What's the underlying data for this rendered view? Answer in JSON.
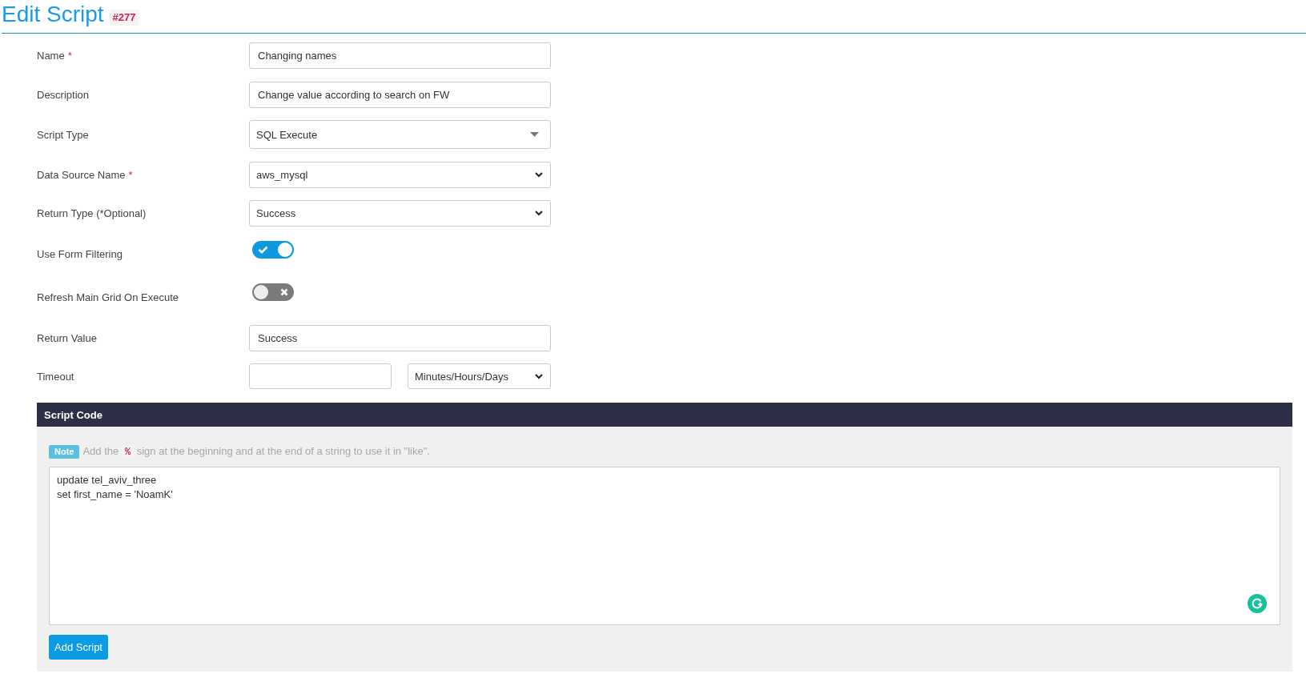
{
  "header": {
    "title": "Edit Script",
    "badge": "#277"
  },
  "form": {
    "fields": [
      {
        "kind": "text",
        "label": "Name",
        "required_mark": "*",
        "value": "Changing names"
      },
      {
        "kind": "text",
        "label": "Description",
        "value": "Change value according to search on FW"
      },
      {
        "kind": "dropdown",
        "label": "Script Type",
        "value": "SQL Execute"
      },
      {
        "kind": "select",
        "label": "Data Source Name",
        "required_mark": "*",
        "value": "aws_mysql"
      },
      {
        "kind": "select",
        "label": "Return Type (*Optional)",
        "value": "Success"
      },
      {
        "kind": "toggle",
        "label": "Use Form Filtering",
        "on": true
      },
      {
        "kind": "toggle",
        "label": "Refresh Main Grid On Execute",
        "on": false
      },
      {
        "kind": "text",
        "label": "Return Value",
        "value": "Success"
      },
      {
        "kind": "duration",
        "label": "Timeout",
        "unit": "Minutes/Hours/Days"
      }
    ]
  },
  "script_code": {
    "title": "Script Code",
    "note": {
      "badge": "Note",
      "text_before": "Add the",
      "code": "%",
      "text_after": "sign at the beginning and at the end of a string to use it in \"like\"."
    },
    "code": "update tel_aviv_three\nset first_name = 'NoamK'",
    "button": "Add Script"
  }
}
